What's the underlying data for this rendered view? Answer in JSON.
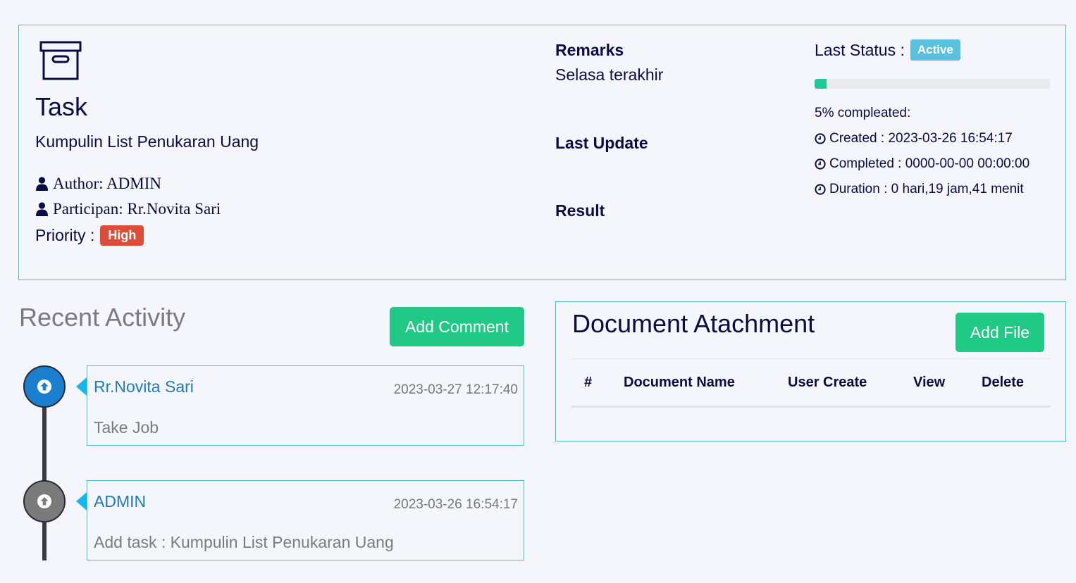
{
  "task": {
    "title": "Task",
    "name": "Kumpulin List Penukaran Uang",
    "author_label": "Author: ADMIN",
    "participant_label": "Participan: Rr.Novita Sari",
    "priority_label": "Priority :",
    "priority_value": "High",
    "remarks_label": "Remarks",
    "remarks_value": "Selasa terakhir",
    "last_update_label": "Last Update",
    "result_label": "Result",
    "last_status_label": "Last Status :",
    "last_status_value": "Active",
    "progress_percent": 5,
    "progress_text": "5% compleated:",
    "created_text": "Created : 2023-03-26 16:54:17",
    "completed_text": "Completed : 0000-00-00 00:00:00",
    "duration_text": "Duration : 0 hari,19 jam,41 menit"
  },
  "recent_activity": {
    "title": "Recent Activity",
    "add_comment_label": "Add Comment",
    "items": [
      {
        "name": "Rr.Novita Sari",
        "time": "2023-03-27 12:17:40",
        "body": "Take Job",
        "color": "#1a7fce"
      },
      {
        "name": "ADMIN",
        "time": "2023-03-26 16:54:17",
        "body": "Add task : Kumpulin List Penukaran Uang",
        "color": "#7b7b7b"
      }
    ]
  },
  "documents": {
    "title": "Document Atachment",
    "add_file_label": "Add File",
    "columns": [
      "#",
      "Document Name",
      "User Create",
      "View",
      "Delete"
    ]
  },
  "colors": {
    "accent_green": "#20c985",
    "high_badge": "#dd4b39",
    "active_badge": "#5bc0de",
    "border_teal": "#3ec1c8"
  },
  "icons": {
    "archive": "archive-box-icon",
    "user": "user-icon",
    "clock": "clock-icon",
    "arrow_up": "arrow-up-icon"
  }
}
